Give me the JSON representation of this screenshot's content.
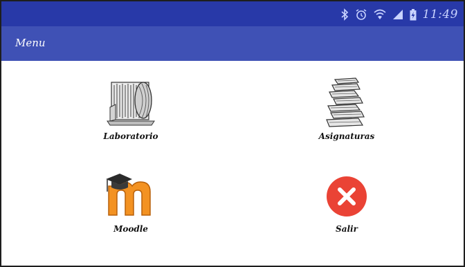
{
  "status_bar": {
    "time": "11:49",
    "icons": [
      "bluetooth-icon",
      "alarm-clock-icon",
      "wifi-icon",
      "cell-signal-icon",
      "battery-charging-icon"
    ]
  },
  "app_bar": {
    "title": "Menu"
  },
  "menu": {
    "items": [
      {
        "label": "Laboratorio",
        "icon": "laboratory-drawing-icon"
      },
      {
        "label": "Asignaturas",
        "icon": "book-stack-icon"
      },
      {
        "label": "Moodle",
        "icon": "moodle-logo-icon"
      },
      {
        "label": "Salir",
        "icon": "exit-x-icon"
      }
    ]
  },
  "colors": {
    "status_bar": "#2839a8",
    "app_bar": "#3f51b5",
    "exit_red": "#ea4335",
    "moodle_orange": "#f39222"
  }
}
